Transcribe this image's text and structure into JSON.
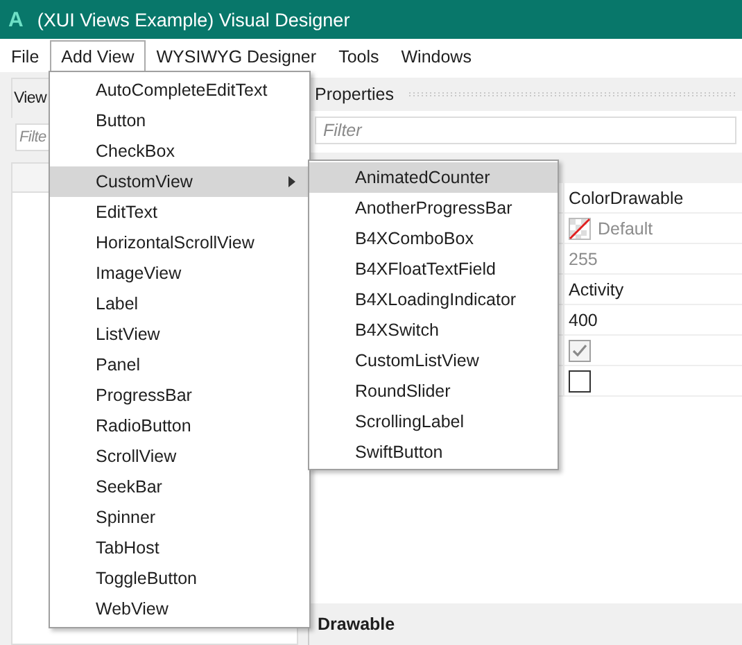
{
  "window": {
    "app_icon": "A",
    "title": "(XUI Views Example) Visual Designer"
  },
  "menu_bar": [
    {
      "label": "File",
      "selected": false
    },
    {
      "label": "Add View",
      "selected": true
    },
    {
      "label": "WYSIWYG Designer",
      "selected": false
    },
    {
      "label": "Tools",
      "selected": false
    },
    {
      "label": "Windows",
      "selected": false
    }
  ],
  "views_panel": {
    "tab": "View",
    "filter": {
      "placeholder": "Filte"
    }
  },
  "properties_panel": {
    "title": "Properties",
    "filter": {
      "placeholder": "Filter"
    },
    "rows": [
      {
        "kind": "text",
        "value": "ColorDrawable",
        "disabled": false
      },
      {
        "kind": "color",
        "value": "Default",
        "disabled": true
      },
      {
        "kind": "text",
        "value": "255",
        "disabled": true
      },
      {
        "kind": "text",
        "value": "Activity",
        "disabled": false
      },
      {
        "kind": "text",
        "value": "400",
        "disabled": false
      },
      {
        "kind": "checkbox",
        "checked": true,
        "disabled": true
      },
      {
        "kind": "checkbox",
        "checked": false,
        "disabled": false
      }
    ],
    "section": "Drawable"
  },
  "add_view_menu": [
    {
      "label": "AutoCompleteEditText",
      "selected": false,
      "submenu": false
    },
    {
      "label": "Button",
      "selected": false,
      "submenu": false
    },
    {
      "label": "CheckBox",
      "selected": false,
      "submenu": false
    },
    {
      "label": "CustomView",
      "selected": true,
      "submenu": true
    },
    {
      "label": "EditText",
      "selected": false,
      "submenu": false
    },
    {
      "label": "HorizontalScrollView",
      "selected": false,
      "submenu": false
    },
    {
      "label": "ImageView",
      "selected": false,
      "submenu": false
    },
    {
      "label": "Label",
      "selected": false,
      "submenu": false
    },
    {
      "label": "ListView",
      "selected": false,
      "submenu": false
    },
    {
      "label": "Panel",
      "selected": false,
      "submenu": false
    },
    {
      "label": "ProgressBar",
      "selected": false,
      "submenu": false
    },
    {
      "label": "RadioButton",
      "selected": false,
      "submenu": false
    },
    {
      "label": "ScrollView",
      "selected": false,
      "submenu": false
    },
    {
      "label": "SeekBar",
      "selected": false,
      "submenu": false
    },
    {
      "label": "Spinner",
      "selected": false,
      "submenu": false
    },
    {
      "label": "TabHost",
      "selected": false,
      "submenu": false
    },
    {
      "label": "ToggleButton",
      "selected": false,
      "submenu": false
    },
    {
      "label": "WebView",
      "selected": false,
      "submenu": false
    }
  ],
  "custom_view_submenu": [
    {
      "label": "AnimatedCounter",
      "selected": true
    },
    {
      "label": "AnotherProgressBar",
      "selected": false
    },
    {
      "label": "B4XComboBox",
      "selected": false
    },
    {
      "label": "B4XFloatTextField",
      "selected": false
    },
    {
      "label": "B4XLoadingIndicator",
      "selected": false
    },
    {
      "label": "B4XSwitch",
      "selected": false
    },
    {
      "label": "CustomListView",
      "selected": false
    },
    {
      "label": "RoundSlider",
      "selected": false
    },
    {
      "label": "ScrollingLabel",
      "selected": false
    },
    {
      "label": "SwiftButton",
      "selected": false
    }
  ]
}
